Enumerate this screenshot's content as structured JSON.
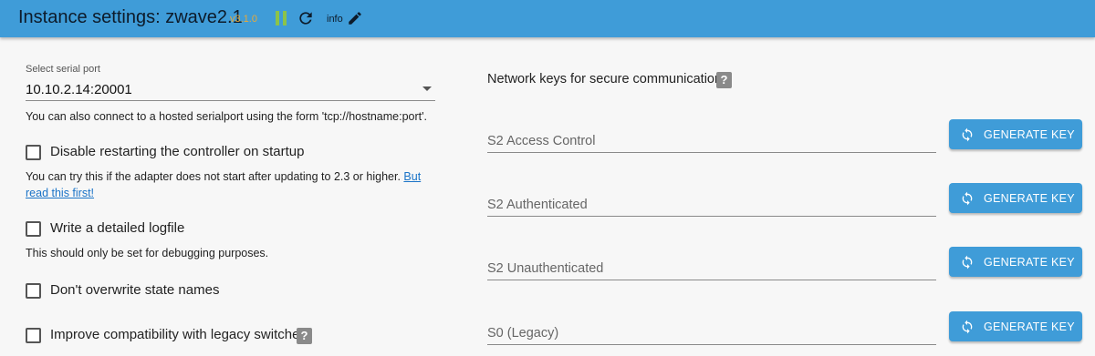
{
  "header": {
    "title": "Instance settings: zwave2.1",
    "version": "v3.1.0",
    "info_label": "info",
    "background_color": "#3f9cd8",
    "icons": [
      "pause-icon",
      "refresh-icon",
      "pencil-icon"
    ]
  },
  "serial": {
    "label": "Select serial port",
    "value": "10.10.2.14:20001",
    "help": "You can also connect to a hosted serialport using the form 'tcp://hostname:port'."
  },
  "options": {
    "disable_restart": {
      "label": "Disable restarting the controller on startup",
      "checked": false,
      "help": "You can try this if the adapter does not start after updating to 2.3 or higher.",
      "link_text_1": "But",
      "link_text_2": "read this first!"
    },
    "logfile": {
      "label": "Write a detailed logfile",
      "checked": false,
      "help": "This should only be set for debugging purposes."
    },
    "overwrite": {
      "label": "Don't overwrite state names",
      "checked": false
    },
    "legacy": {
      "label": "Improve compatibility with legacy switches",
      "checked": false,
      "help_icon": "?"
    }
  },
  "keys": {
    "title": "Network keys for secure communication",
    "help_icon": "?",
    "button_label": "GENERATE KEY",
    "fields": [
      {
        "label": "S2 Access Control",
        "value": ""
      },
      {
        "label": "S2 Authenticated",
        "value": ""
      },
      {
        "label": "S2 Unauthenticated",
        "value": ""
      },
      {
        "label": "S0 (Legacy)",
        "value": ""
      }
    ]
  }
}
